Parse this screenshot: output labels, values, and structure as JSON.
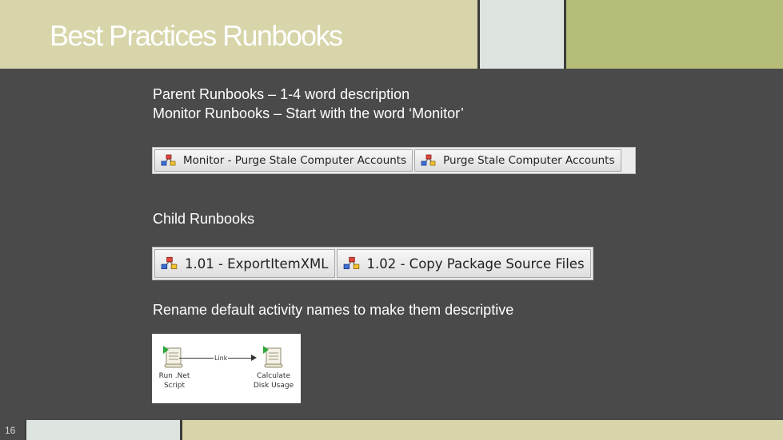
{
  "title": "Best Practices Runbooks",
  "parent_line": "Parent Runbooks – 1-4 word description",
  "monitor_line": "Monitor Runbooks – Start with the word ‘Monitor’",
  "parent_tabs": [
    "Monitor - Purge Stale Computer Accounts",
    "Purge Stale Computer Accounts"
  ],
  "child_heading": "Child Runbooks",
  "child_tabs": [
    "1.01 - ExportItemXML",
    "1.02 - Copy Package Source Files"
  ],
  "rename_line": "Rename default activity names to make them descriptive",
  "diagram": {
    "link_label": "Link",
    "activity1": [
      "Run .Net",
      "Script"
    ],
    "activity2": [
      "Calculate",
      "Disk Usage"
    ]
  },
  "slide_number": "16",
  "icons": [
    "runbook-icon",
    "activity-icon"
  ],
  "colors": {
    "background": "#4a4a4a",
    "header_tan": "#d7d5a9",
    "header_light": "#dde4df",
    "header_green": "#b5bd79",
    "text": "#ffffff"
  }
}
